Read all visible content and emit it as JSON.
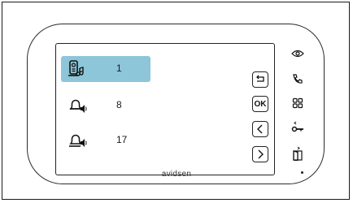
{
  "brand": "avidsen",
  "screen": {
    "rows": [
      {
        "icon": "doorbell-speaker-icon",
        "value": "1",
        "selected": true
      },
      {
        "icon": "bell-speaker-icon",
        "value": "8",
        "selected": false
      },
      {
        "icon": "handset-speaker-icon",
        "value": "17",
        "selected": false
      }
    ],
    "selected_color": "#8dc5d9"
  },
  "nav_buttons": [
    {
      "name": "back-button",
      "icon": "return-arrow-icon"
    },
    {
      "name": "ok-button",
      "label": "OK"
    },
    {
      "name": "left-button",
      "icon": "chevron-left-icon"
    },
    {
      "name": "right-button",
      "icon": "chevron-right-icon"
    }
  ],
  "side_buttons": [
    {
      "name": "camera-view-button",
      "icon": "eye-icon"
    },
    {
      "name": "call-button",
      "icon": "phone-icon"
    },
    {
      "name": "menu-button",
      "icon": "grid-icon"
    },
    {
      "name": "gate-button",
      "icon": "key-icon"
    },
    {
      "name": "door-button",
      "icon": "door-open-icon"
    }
  ]
}
